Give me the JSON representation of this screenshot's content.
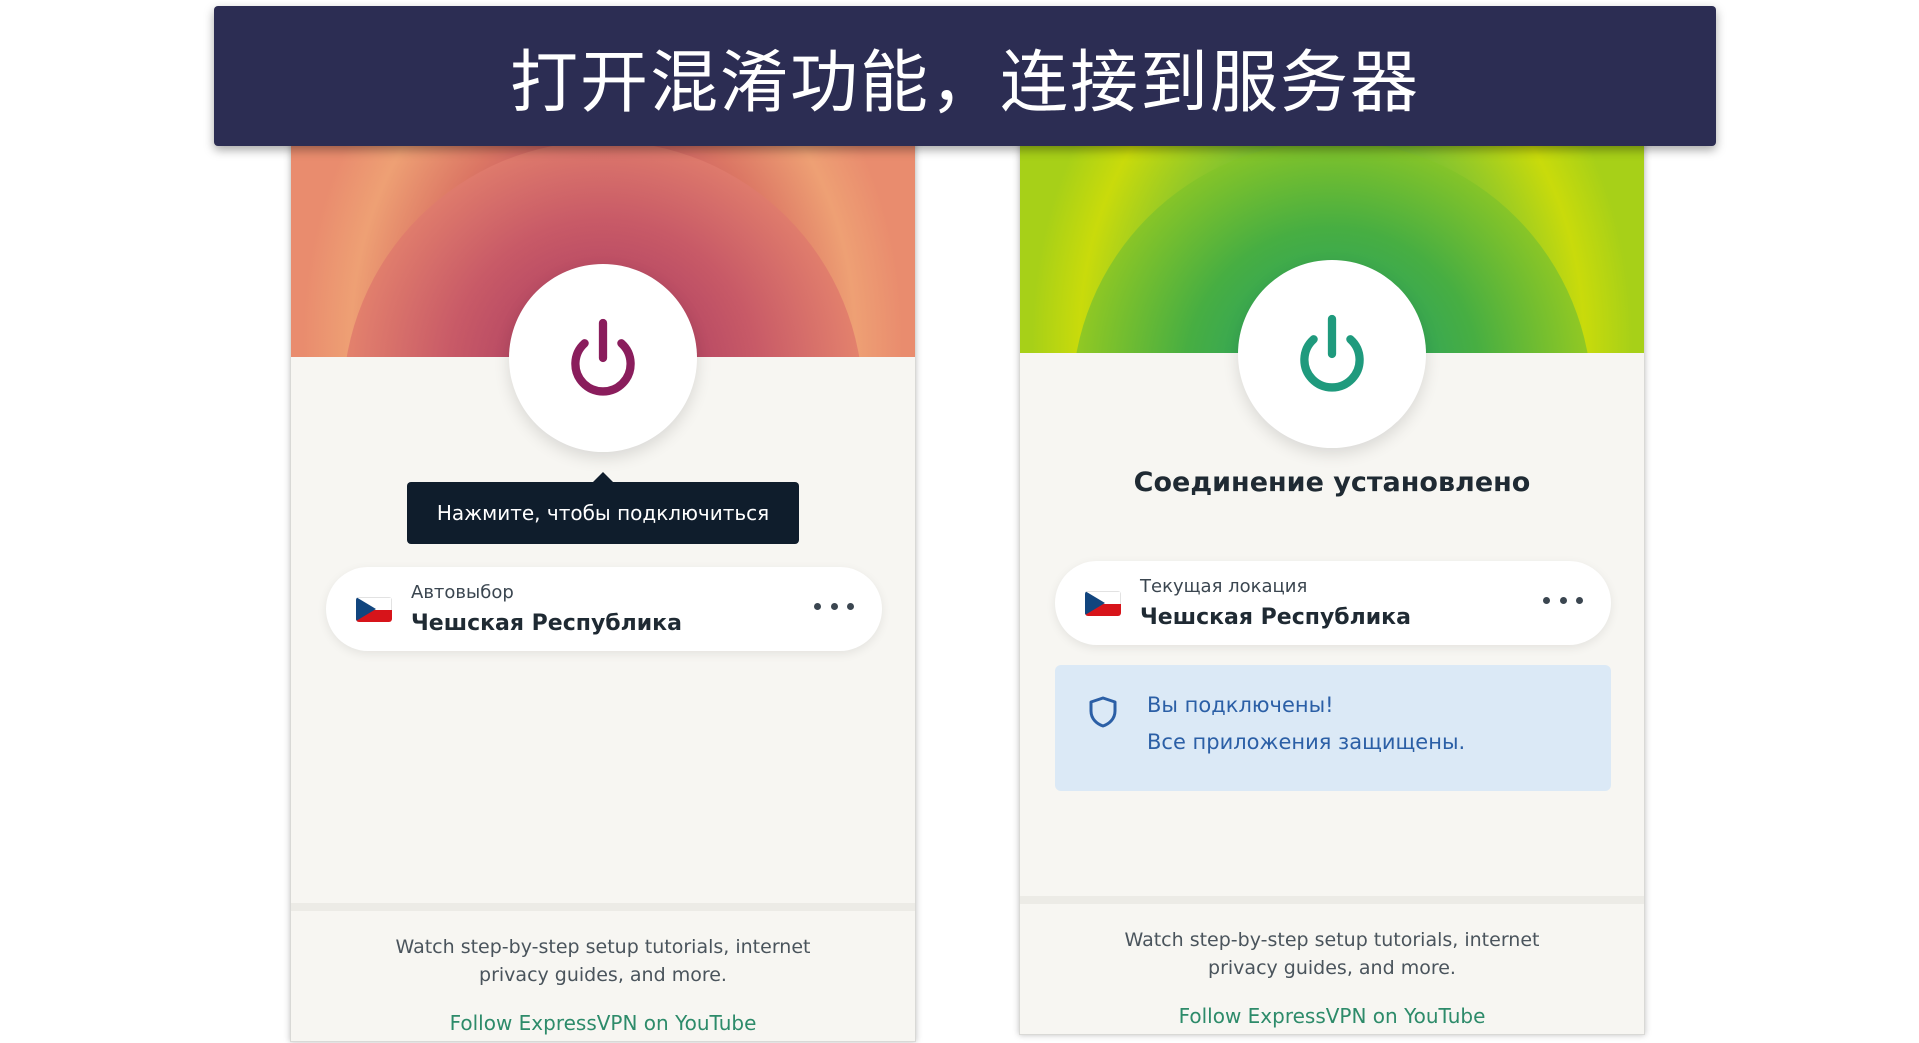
{
  "banner": {
    "title": "打开混淆功能，连接到服务器"
  },
  "left_app": {
    "tooltip": "Нажмите, чтобы подключиться",
    "location": {
      "label": "Автовыбор",
      "country": "Чешская Республика"
    },
    "footer": {
      "text": "Watch step-by-step setup tutorials, internet privacy guides, and more.",
      "link": "Follow ExpressVPN on YouTube"
    },
    "power_icon_color": "#8a1d5c",
    "icons": [
      "power-icon",
      "czech-flag-icon",
      "more-options-icon"
    ]
  },
  "right_app": {
    "status": "Соединение установлено",
    "location": {
      "label": "Текущая локация",
      "country": "Чешская Республика"
    },
    "info": {
      "line1": "Вы подключены!",
      "line2": "Все приложения защищены."
    },
    "footer": {
      "text": "Watch step-by-step setup tutorials, internet privacy guides, and more.",
      "link": "Follow ExpressVPN on YouTube"
    },
    "power_icon_color": "#1f9a7d",
    "icons": [
      "power-icon",
      "czech-flag-icon",
      "more-options-icon",
      "shield-icon"
    ]
  },
  "colors": {
    "banner_bg": "#2c2d53",
    "tooltip_bg": "#0f1d2c",
    "link": "#2d8b6a",
    "info_bg": "#dbe9f6",
    "info_text": "#2b5fa6"
  }
}
